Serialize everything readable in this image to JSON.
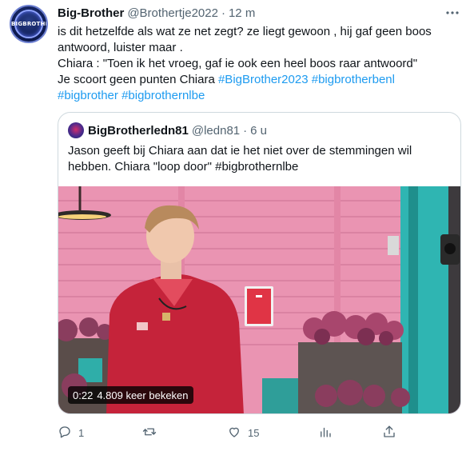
{
  "tweet": {
    "display_name": "Big-Brother",
    "handle": "@Brothertje2022",
    "dot": "·",
    "time": "12 m",
    "avatar_text": "BIGBROTHER",
    "lines": [
      "is dit hetzelfde als wat ze net zegt? ze liegt gewoon , hij gaf geen boos",
      "antwoord, luister maar .",
      "Chiara : \"Toen ik het vroeg, gaf ie ook een heel boos raar antwoord\""
    ],
    "line4_text": "Je scoort geen punten Chiara",
    "hashtags_line4": [
      "#BigBrother2023",
      "#bigbrotherbenl"
    ],
    "hashtags_line5": [
      "#bigbrother",
      "#bigbrothernlbe"
    ]
  },
  "quoted": {
    "display_name": "BigBrotherledn81",
    "handle": "@ledn81",
    "dot": "·",
    "time": "6 u",
    "lines": [
      "Jason geeft bij Chiara aan dat ie het niet over de stemmingen wil",
      "hebben. Chiara \"loop door\" #bigbrothernlbe"
    ],
    "video": {
      "duration": "0:22",
      "views": "4.809 keer bekeken"
    }
  },
  "actions": {
    "reply_count": "1",
    "retweet_count": "",
    "like_count": "15",
    "icons": [
      "reply-icon",
      "retweet-icon",
      "like-icon",
      "analytics-icon",
      "share-icon"
    ]
  },
  "colors": {
    "link": "#1d9bf0",
    "text": "#0f1419",
    "secondary": "#536471",
    "border": "#cfd9de"
  }
}
